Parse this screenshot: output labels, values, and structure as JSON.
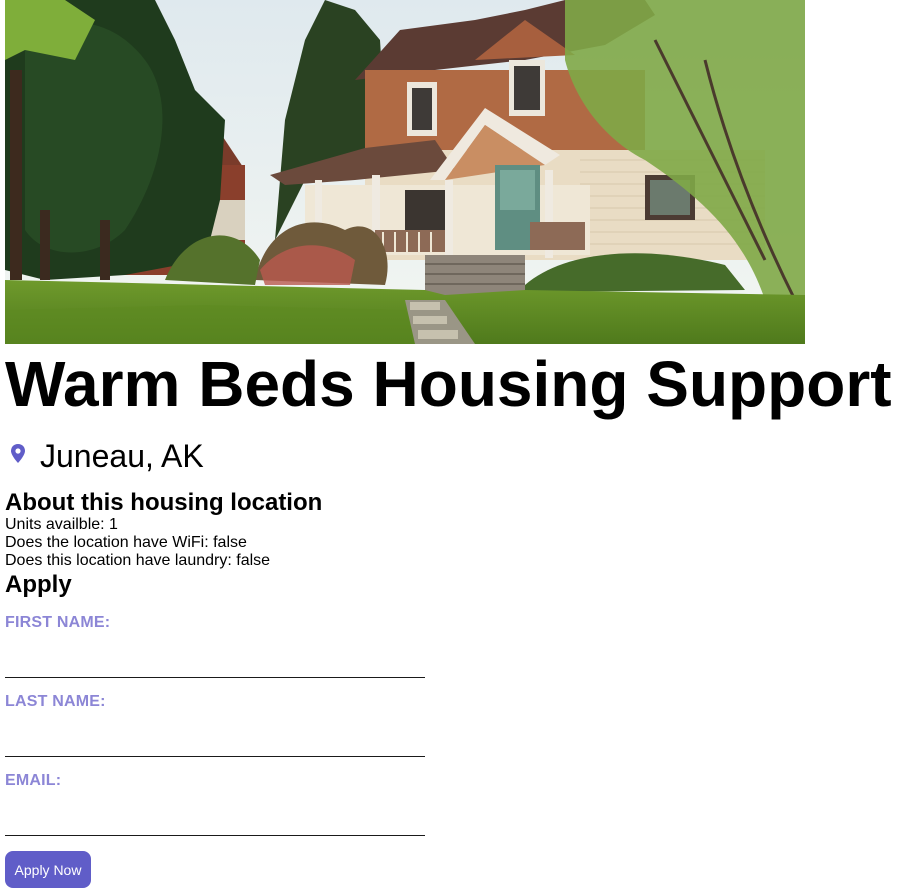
{
  "listing": {
    "image_alt": "Exterior photo of Warm Beds Housing Support",
    "name": "Warm Beds Housing Support",
    "location": "Juneau, AK",
    "location_icon": "map-pin-icon"
  },
  "about": {
    "heading": "About this housing location",
    "units": "Units availble: 1",
    "wifi": "Does the location have WiFi: false",
    "laundry": "Does this location have laundry: false"
  },
  "apply": {
    "heading": "Apply",
    "first_name_label": "FIRST NAME:",
    "first_name_value": "",
    "last_name_label": "LAST NAME:",
    "last_name_value": "",
    "email_label": "EMAIL:",
    "email_value": "",
    "button_label": "Apply Now"
  },
  "colors": {
    "accent": "#605dc8",
    "label": "#8c86d6"
  }
}
